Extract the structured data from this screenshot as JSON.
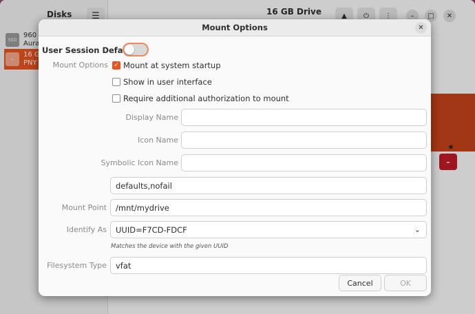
{
  "background": {
    "sidebar_title": "Disks",
    "window_title": "16 GB Drive",
    "drives": [
      {
        "name": "960",
        "sub": "Aura",
        "icon_text": "SSD"
      },
      {
        "name": "16 G",
        "sub": "PNY"
      }
    ],
    "icons": [
      "hamburger-menu-icon",
      "eject-icon",
      "power-icon",
      "kebab-menu-icon",
      "minimize-icon",
      "maximize-icon",
      "close-icon",
      "star-icon",
      "minus-icon"
    ],
    "colors": {
      "accent": "#e95420",
      "partition": "#c6441b",
      "destructive": "#c01c28"
    }
  },
  "dialog": {
    "title": "Mount Options",
    "user_session_defaults_label": "User Session Defaults",
    "user_session_defaults_on": false,
    "mount_options_label": "Mount Options",
    "checkboxes": [
      {
        "label": "Mount at system startup",
        "checked": true
      },
      {
        "label": "Show in user interface",
        "checked": false
      },
      {
        "label": "Require additional authorization to mount",
        "checked": false
      }
    ],
    "display_name_label": "Display Name",
    "display_name_value": "",
    "icon_name_label": "Icon Name",
    "icon_name_value": "",
    "symbolic_icon_name_label": "Symbolic Icon Name",
    "symbolic_icon_name_value": "",
    "options_value": "defaults,nofail",
    "mount_point_label": "Mount Point",
    "mount_point_value": "/mnt/mydrive",
    "identify_as_label": "Identify As",
    "identify_as_value": "UUID=F7CD-FDCF",
    "identify_as_hint": "Matches the device with the given UUID",
    "filesystem_type_label": "Filesystem Type",
    "filesystem_type_value": "vfat",
    "cancel_label": "Cancel",
    "ok_label": "OK"
  }
}
